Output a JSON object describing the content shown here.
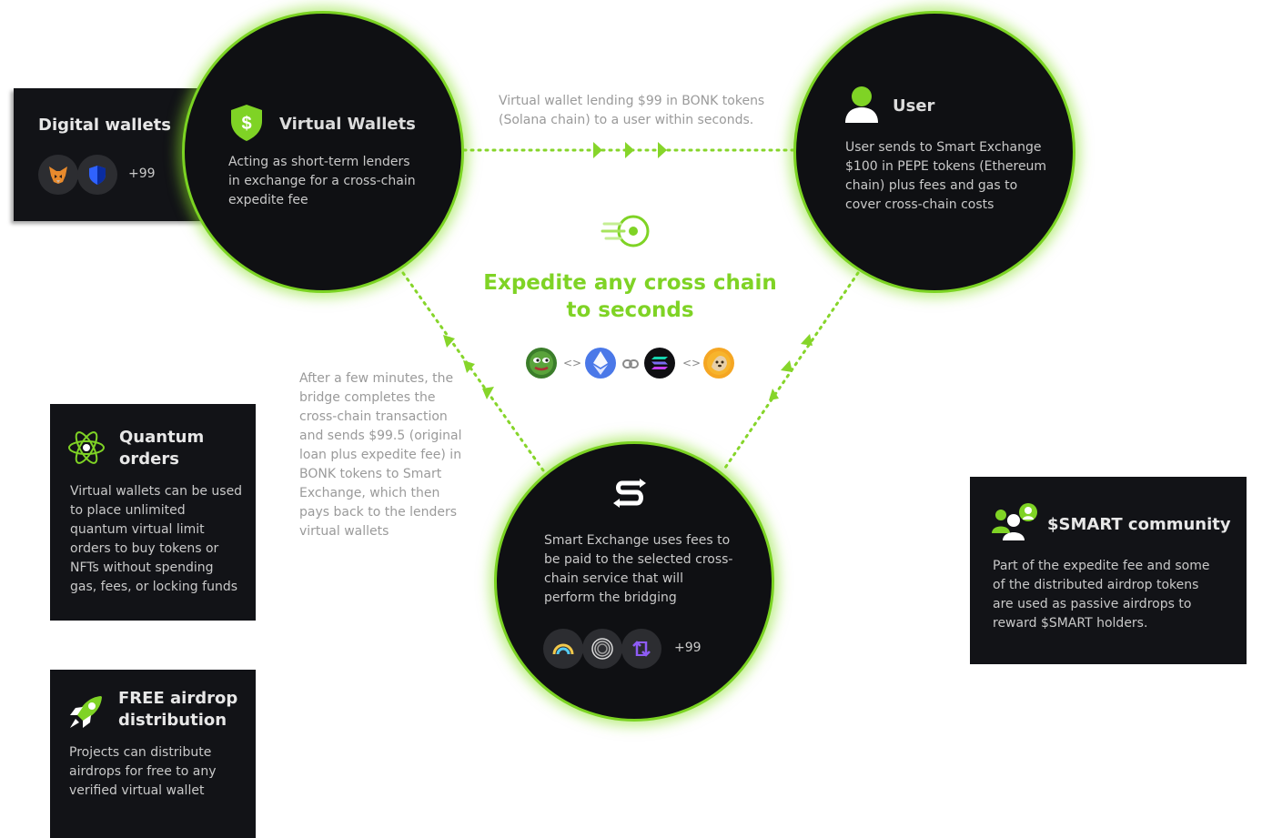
{
  "digital_wallets": {
    "title": "Digital wallets",
    "more": "+99",
    "icons": [
      "metamask-fox-icon",
      "shield-wallet-icon"
    ]
  },
  "virtual_wallets": {
    "title": "Virtual Wallets",
    "body": "Acting as short-term lenders in exchange for a cross-chain expedite fee",
    "icon": "dollar-shield-icon"
  },
  "user": {
    "title": "User",
    "body": "User sends to Smart Exchange $100 in PEPE tokens (Ethereum chain) plus fees and gas to cover cross-chain costs",
    "icon": "user-icon"
  },
  "lending_note": "Virtual wallet lending $99 in BONK tokens (Solana chain) to a user within seconds.",
  "hero": {
    "title": "Expedite any cross chain to seconds",
    "icon": "fast-target-icon",
    "separators": [
      "<>",
      "<>"
    ],
    "chain_icons": [
      "pepe-icon",
      "ethereum-icon",
      "link-icon",
      "solana-icon",
      "bonk-icon"
    ]
  },
  "bridge_note": "After a few minutes, the bridge completes the cross-chain transaction and sends $99.5 (original loan plus expedite fee) in BONK tokens to Smart Exchange, which then pays back to the lenders virtual wallets",
  "smart_exchange": {
    "body": "Smart Exchange uses  fees to be paid to the selected cross-chain service that will perform the bridging",
    "more": "+99",
    "icons": [
      "smart-exchange-logo-icon",
      "rainbow-bridge-icon",
      "ring-icon",
      "swap-arrows-icon"
    ]
  },
  "quantum": {
    "title": "Quantum orders",
    "body": "Virtual wallets can be used to place unlimited quantum virtual limit orders to buy tokens or NFTs without spending gas, fees, or locking funds",
    "icon": "atom-icon"
  },
  "airdrop": {
    "title": "FREE airdrop distribution",
    "body": "Projects can distribute airdrops for free to any verified virtual wallet",
    "icon": "rocket-icon"
  },
  "community": {
    "title": "$SMART community",
    "body": "Part of the expedite fee and some of the distributed airdrop tokens are used as passive airdrops to reward $SMART holders.",
    "icon": "community-icon"
  },
  "colors": {
    "accent": "#7fd325",
    "panel": "#121317",
    "circle_border": "#7bd322"
  }
}
